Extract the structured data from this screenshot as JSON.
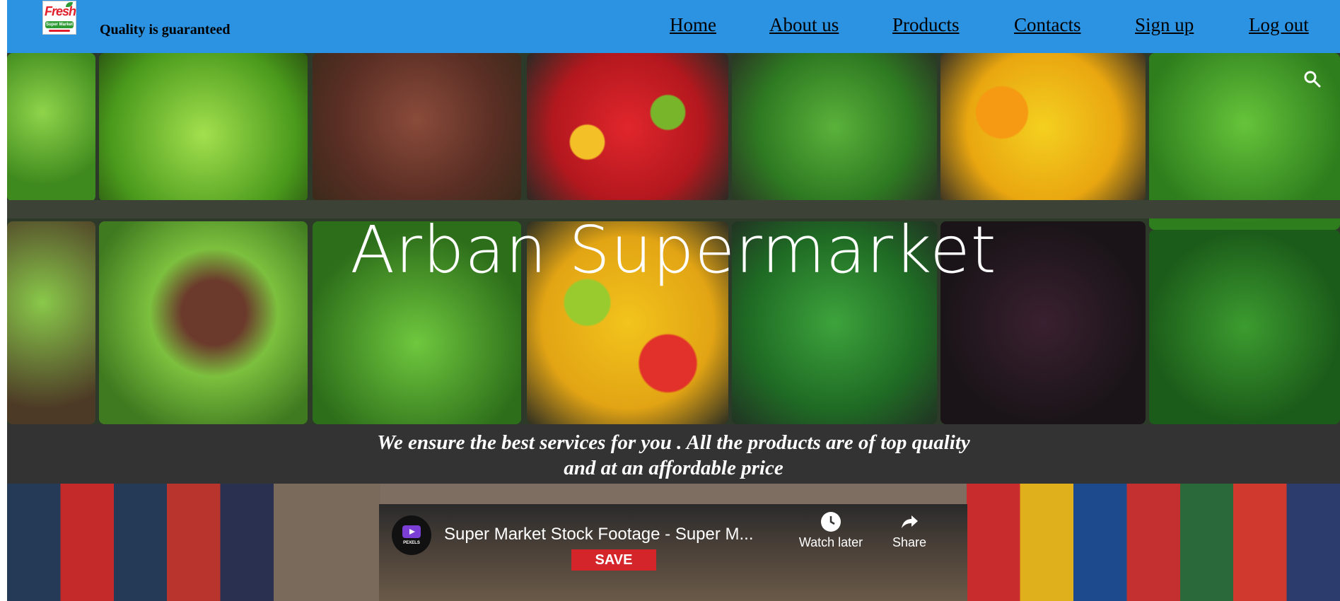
{
  "header": {
    "logo_text": "Fresh",
    "logo_subtext": "Super Market",
    "tagline": "Quality is guaranteed",
    "nav": [
      {
        "label": "Home"
      },
      {
        "label": "About us"
      },
      {
        "label": "Products"
      },
      {
        "label": "Contacts"
      },
      {
        "label": "Sign up"
      },
      {
        "label": "Log out"
      }
    ],
    "bg_color": "#2b93e2"
  },
  "hero": {
    "title": "Arban Supermarket",
    "search_icon": "search-icon"
  },
  "banner": {
    "line1": "We ensure the best services for you . All the products are of top quality",
    "line2": "and at an affordable price",
    "bg_color": "#333333"
  },
  "video": {
    "channel": "PEXELS",
    "title": "Super Market Stock Footage - Super M...",
    "watch_later": "Watch later",
    "share": "Share",
    "sign": "SAVE"
  }
}
